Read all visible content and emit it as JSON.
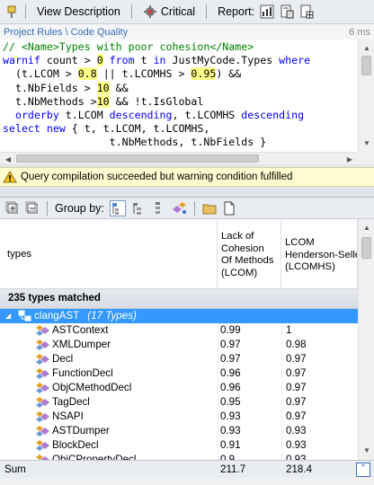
{
  "toolbar": {
    "view_description": "View Description",
    "critical": "Critical",
    "report": "Report:"
  },
  "breadcrumb": {
    "parent": "Project Rules",
    "sep": "\\",
    "current": "Code Quality",
    "duration": "6 ms"
  },
  "code": {
    "l1_comment": "// <Name>Types with poor cohesion</Name>",
    "l2_kw1": "warnif",
    "l2_t1": " count > ",
    "l2_n1": "0",
    "l2_kw2": " from",
    "l2_t2": " t ",
    "l2_kw3": "in",
    "l2_t3": " JustMyCode.Types ",
    "l2_kw4": "where",
    "l3_t1": "  (t.LCOM > ",
    "l3_n1": "0.8",
    "l3_t2": " || t.LCOMHS > ",
    "l3_n2": "0.95",
    "l3_t3": ") &&",
    "l4_t1": "  t.NbFields > ",
    "l4_n1": "10",
    "l4_t2": " &&",
    "l5_t1": "  t.NbMethods >",
    "l5_n1": "10",
    "l5_t2": " && !t.IsGlobal",
    "l6_kw1": "  orderby",
    "l6_t1": " t.LCOM ",
    "l6_kw2": "descending",
    "l6_t2": ", t.LCOMHS ",
    "l6_kw3": "descending",
    "l7_kw1": "select",
    "l7_kw2": " new",
    "l7_t1": " { t, t.LCOM, t.LCOMHS,",
    "l8_t1": "                 t.NbMethods, t.NbFields }"
  },
  "status": {
    "message": "Query compilation succeeded but warning condition fulfilled"
  },
  "results_toolbar": {
    "group_by": "Group by:"
  },
  "grid": {
    "col_types": "types",
    "col_lcom_1": "Lack of",
    "col_lcom_2": "Cohesion",
    "col_lcom_3": "Of Methods",
    "col_lcom_4": "(LCOM)",
    "col_lcomhs_1": "LCOM",
    "col_lcomhs_2": "Henderson-Sellers",
    "col_lcomhs_3": "(LCOMHS)",
    "matched": "235 types matched",
    "group": {
      "name": "clangAST",
      "count": "(17 Types)"
    },
    "rows": [
      {
        "name": "ASTContext",
        "lcom": "0.99",
        "lcomhs": "1"
      },
      {
        "name": "XMLDumper",
        "lcom": "0.97",
        "lcomhs": "0.98"
      },
      {
        "name": "Decl",
        "lcom": "0.97",
        "lcomhs": "0.97"
      },
      {
        "name": "FunctionDecl",
        "lcom": "0.96",
        "lcomhs": "0.97"
      },
      {
        "name": "ObjCMethodDecl",
        "lcom": "0.96",
        "lcomhs": "0.97"
      },
      {
        "name": "TagDecl",
        "lcom": "0.95",
        "lcomhs": "0.97"
      },
      {
        "name": "NSAPI",
        "lcom": "0.93",
        "lcomhs": "0.97"
      },
      {
        "name": "ASTDumper",
        "lcom": "0.93",
        "lcomhs": "0.93"
      },
      {
        "name": "BlockDecl",
        "lcom": "0.91",
        "lcomhs": "0.93"
      },
      {
        "name": "ObjCPropertyDecl",
        "lcom": "0.9",
        "lcomhs": "0.93"
      }
    ],
    "sum_label": "Sum",
    "sum_lcom": "211.7",
    "sum_lcomhs": "218.4"
  },
  "colors": {
    "selection": "#3399ff",
    "link": "#3a6fb7",
    "keyword": "#0000ff",
    "comment": "#008000",
    "number_highlight": "#ffff88",
    "warning_bg": "#fffbd0"
  }
}
